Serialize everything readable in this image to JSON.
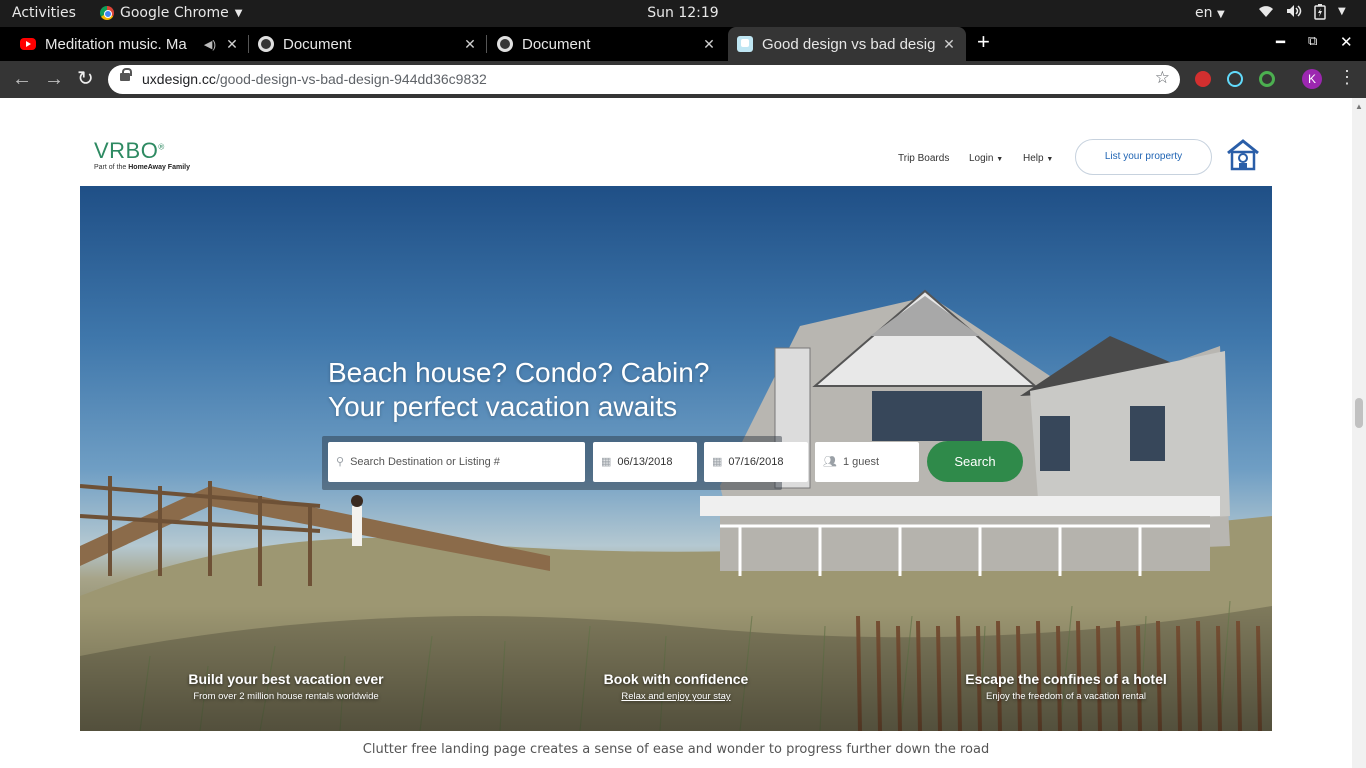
{
  "system_bar": {
    "activities": "Activities",
    "app_name": "Google Chrome",
    "clock": "Sun 12:19",
    "language": "en"
  },
  "tabs": [
    {
      "title": "Meditation music. Ma",
      "favicon": "youtube-icon"
    },
    {
      "title": "Document",
      "favicon": "globe-icon"
    },
    {
      "title": "Document",
      "favicon": "globe-icon"
    },
    {
      "title": "Good design vs bad desig",
      "favicon": "uxdesign-icon",
      "active": true
    }
  ],
  "omnibox": {
    "domain": "uxdesign.cc",
    "path": "/good-design-vs-bad-design-944dd36c9832"
  },
  "profile": {
    "initial": "K",
    "color": "#9c27b0"
  },
  "vrbo": {
    "brand": "VRBO",
    "tagline_prefix": "Part of the",
    "tagline_brand": "HomeAway Family",
    "nav": {
      "trip_boards": "Trip Boards",
      "login": "Login",
      "help": "Help",
      "list_property": "List your property"
    },
    "hero": {
      "line1": "Beach house? Condo? Cabin?",
      "line2": "Your perfect vacation awaits"
    },
    "search": {
      "destination_placeholder": "Search Destination or Listing #",
      "checkin": "06/13/2018",
      "checkout": "07/16/2018",
      "guests": "1 guest",
      "button": "Search"
    },
    "features": [
      {
        "title": "Build your best vacation ever",
        "subtitle": "From over 2 million house rentals worldwide"
      },
      {
        "title": "Book with confidence",
        "subtitle": "Relax and enjoy your stay"
      },
      {
        "title": "Escape the confines of a hotel",
        "subtitle": "Enjoy the freedom of a vacation rental"
      }
    ]
  },
  "caption": "Clutter free landing page creates a sense of ease and wonder to progress further down the road",
  "colors": {
    "vrbo_green": "#2e8a62",
    "search_button": "#2f8a4a",
    "link_blue": "#2165b4"
  }
}
